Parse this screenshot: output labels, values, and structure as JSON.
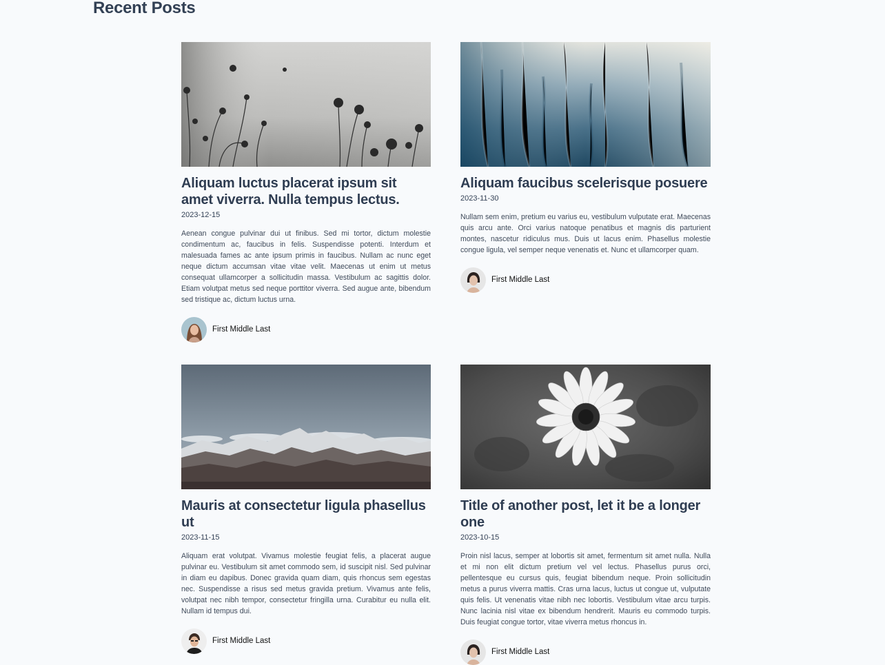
{
  "section": {
    "title": "Recent Posts"
  },
  "posts": [
    {
      "title": "Aliquam luctus placerat ipsum sit amet viverra. Nulla tempus lectus.",
      "date": "2023-12-15",
      "excerpt": "Aenean congue pulvinar dui ut finibus. Sed mi tortor, dictum molestie condimentum ac, faucibus in felis. Suspendisse potenti. Interdum et malesuada fames ac ante ipsum primis in faucibus. Nullam ac nunc eget neque dictum accumsan vitae vitae velit. Maecenas ut enim ut metus consequat ullamcorper a sollicitudin massa. Vestibulum ac sagittis dolor. Etiam volutpat metus sed neque porttitor viverra. Sed augue ante, bibendum sed tristique ac, dictum luctus urna.",
      "author": "First Middle Last",
      "image": "flowers-mist-photo"
    },
    {
      "title": "Aliquam faucibus scelerisque posuere",
      "date": "2023-11-30",
      "excerpt": "Nullam sem enim, pretium eu varius eu, vestibulum vulputate erat. Maecenas quis arcu ante. Orci varius natoque penatibus et magnis dis parturient montes, nascetur ridiculus mus. Duis ut lacus enim. Phasellus molestie congue ligula, vel semper neque venenatis et. Nunc et ullamcorper quam.",
      "author": "First Middle Last",
      "image": "blue-abstract-photo"
    },
    {
      "title": "Mauris at consectetur ligula phasellus ut",
      "date": "2023-11-15",
      "excerpt": "Aliquam erat volutpat. Vivamus molestie feugiat felis, a placerat augue pulvinar eu. Vestibulum sit amet commodo sem, id suscipit nisl. Sed pulvinar in diam eu dapibus. Donec gravida quam diam, quis rhoncus sem egestas nec. Suspendisse a risus sed metus gravida pretium. Vivamus ante felis, volutpat nec nibh tempor, consectetur fringilla urna. Curabitur eu nulla elit. Nullam id tempus dui.",
      "author": "First Middle Last",
      "image": "mountains-photo"
    },
    {
      "title": "Title of another post, let it be a longer one",
      "date": "2023-10-15",
      "excerpt": "Proin nisl lacus, semper at lobortis sit amet, fermentum sit amet nulla. Nulla et mi non elit dictum pretium vel vel lectus. Phasellus purus orci, pellentesque eu cursus quis, feugiat bibendum neque. Proin sollicitudin metus a purus viverra mattis. Cras urna lacus, luctus ut congue ut, vulputate quis felis. Ut venenatis vitae nibh nec lobortis. Vestibulum vitae arcu turpis. Nunc lacinia nisl vitae ex bibendum hendrerit. Mauris eu commodo turpis. Duis feugiat congue tortor, vitae viverra metus rhoncus in.",
      "author": "First Middle Last",
      "image": "daisy-photo"
    }
  ]
}
